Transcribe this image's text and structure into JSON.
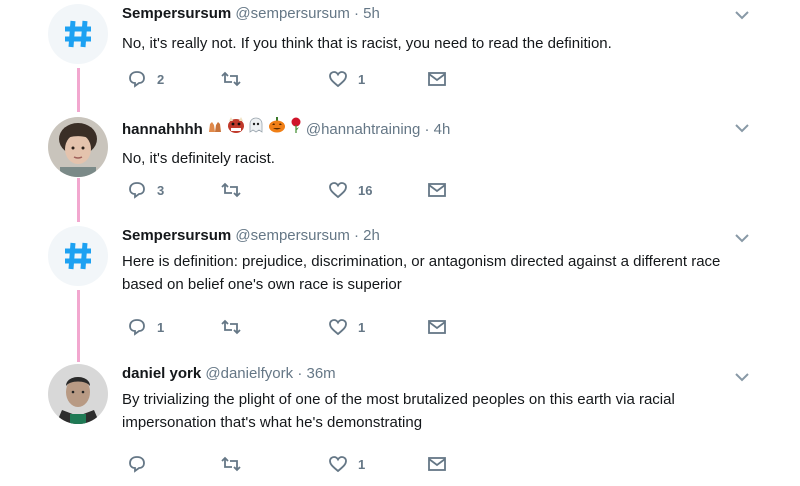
{
  "tweets": [
    {
      "name": "Sempersursum",
      "handle": "@sempersursum",
      "time": "· 5h",
      "text": "No, it's really not. If you think that is racist, you need to read the definition.",
      "replies": "2",
      "retweets": "",
      "likes": "1",
      "avatar": "hashtag-avatar"
    },
    {
      "name": "hannahhhh",
      "handle": "@hannahtraining",
      "time": "· 4h",
      "text": "No, it's definitely racist.",
      "replies": "3",
      "retweets": "",
      "likes": "16",
      "avatar": "user-photo-avatar",
      "emojis": [
        "raised-hands-emoji",
        "ogre-emoji",
        "ghost-emoji",
        "jack-o-lantern-emoji",
        "rose-emoji"
      ]
    },
    {
      "name": "Sempersursum",
      "handle": "@sempersursum",
      "time": "· 2h",
      "text": "Here is definition: prejudice, discrimination, or antagonism directed against a different race based on belief one's own race is superior",
      "replies": "1",
      "retweets": "",
      "likes": "1",
      "avatar": "hashtag-avatar"
    },
    {
      "name": "daniel york",
      "handle": "@danielfyork",
      "time": "· 36m",
      "text": "By trivializing the plight of one of the most brutalized peoples on this earth via racial impersonation that's what he's demonstrating",
      "replies": "",
      "retweets": "",
      "likes": "1",
      "avatar": "user-photo-avatar"
    }
  ],
  "colors": {
    "thread_line": "#f2a7cf",
    "hashtag_blue": "#1da1f2",
    "meta_gray": "#657786"
  },
  "icons": [
    "reply-icon",
    "retweet-icon",
    "like-icon",
    "direct-message-icon",
    "chevron-down-icon"
  ]
}
